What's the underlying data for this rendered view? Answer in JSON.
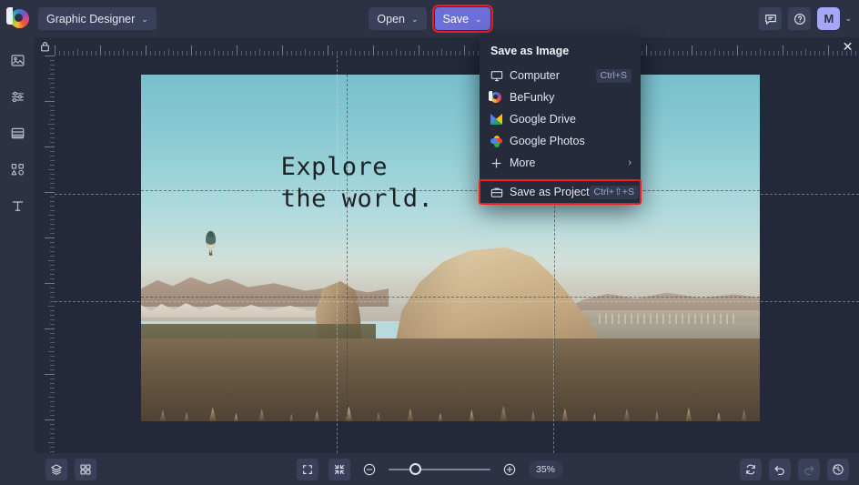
{
  "topbar": {
    "logo": "befunky-logo",
    "workspace": {
      "label": "Graphic Designer",
      "chevron": "⌄"
    },
    "open": {
      "label": "Open",
      "chevron": "⌄"
    },
    "save": {
      "label": "Save",
      "chevron": "⌄",
      "highlight_color": "#ef1d22",
      "bg_color": "#6c6fd8"
    },
    "feedback_icon": "chat-icon",
    "help_icon": "help-circle-icon",
    "avatar": {
      "initial": "M",
      "bg_color": "#a5a6f6",
      "chevron": "⌄"
    }
  },
  "sidebar": {
    "items": [
      {
        "name": "image",
        "icon": "image-icon"
      },
      {
        "name": "edit",
        "icon": "sliders-icon"
      },
      {
        "name": "templates",
        "icon": "layout-icon"
      },
      {
        "name": "graphics",
        "icon": "shapes-icon"
      },
      {
        "name": "text",
        "icon": "text-t-icon",
        "glyph": "T"
      }
    ]
  },
  "ruler": {
    "lock_icon": "lock-icon",
    "close_icon": "close-x-icon",
    "close_glyph": "✕"
  },
  "save_menu": {
    "header": "Save as Image",
    "items": [
      {
        "label": "Computer",
        "icon": "monitor-icon",
        "shortcut": "Ctrl+S",
        "arrow": ""
      },
      {
        "label": "BeFunky",
        "icon": "befunky-icon",
        "shortcut": "",
        "arrow": ""
      },
      {
        "label": "Google Drive",
        "icon": "google-drive-icon",
        "shortcut": "",
        "arrow": ""
      },
      {
        "label": "Google Photos",
        "icon": "google-photos-icon",
        "shortcut": "",
        "arrow": ""
      },
      {
        "label": "More",
        "icon": "plus-icon",
        "shortcut": "",
        "arrow": "›"
      }
    ],
    "project": {
      "label": "Save as Project",
      "icon": "briefcase-icon",
      "shortcut": "Ctrl+⇧+S",
      "highlight_color": "#ef1d22"
    }
  },
  "canvas": {
    "text_line1": "Explore",
    "text_line2": "the world.",
    "artboard_bg": "#b9d9dd",
    "image_description": "cappadocia-landscape-with-hot-air-balloons"
  },
  "bottombar": {
    "layers_icon": "layers-icon",
    "grid_icon": "grid-icon",
    "fullscreen_icon": "expand-icon",
    "fit_icon": "collapse-icon",
    "zoom_out_icon": "minus-circle-icon",
    "zoom_in_icon": "plus-circle-icon",
    "zoom_value": "35%",
    "zoom_percent": 35,
    "reset_icon": "reset-icon",
    "undo_icon": "undo-icon",
    "redo_icon": "redo-icon",
    "history_icon": "history-icon"
  }
}
